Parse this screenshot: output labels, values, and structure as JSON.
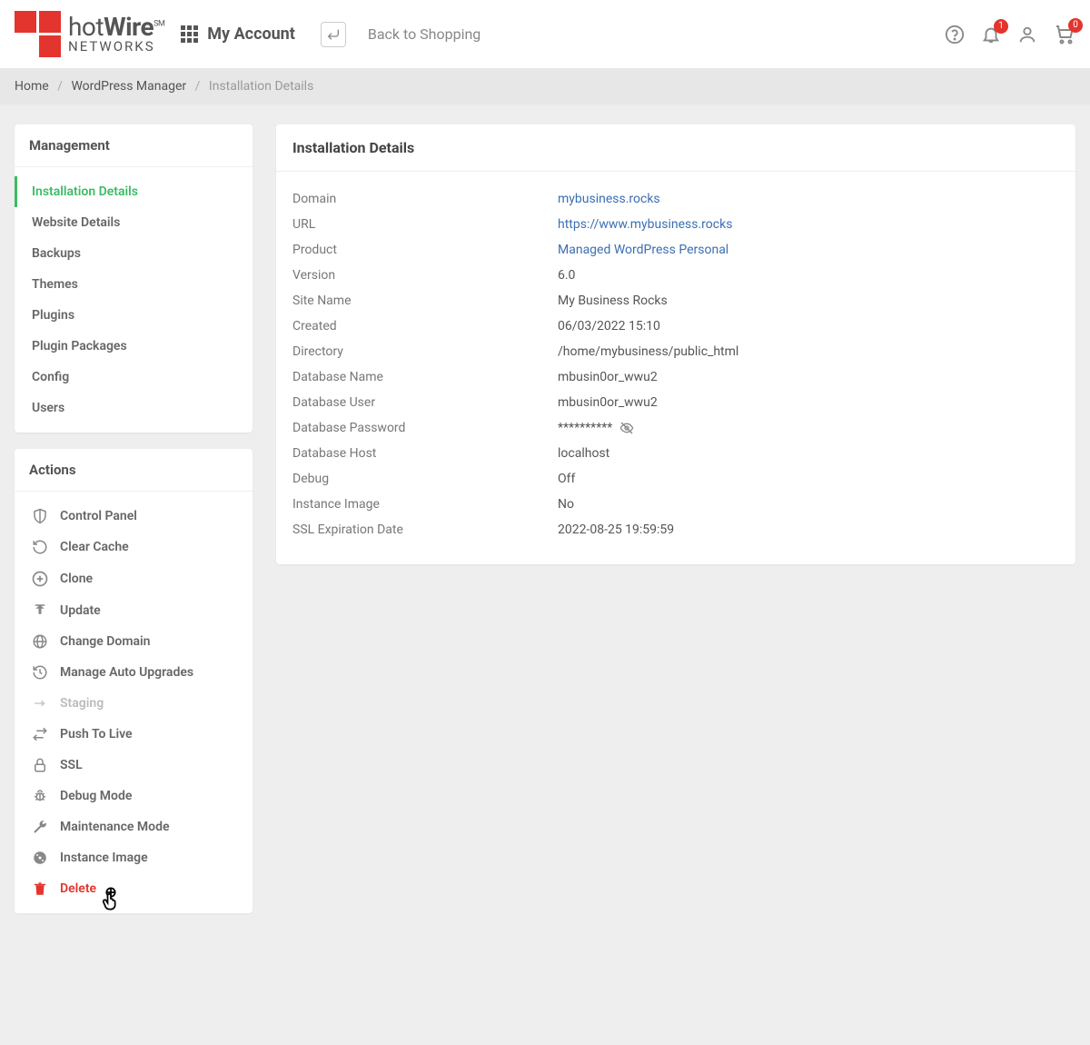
{
  "header": {
    "logo_top1": "hot",
    "logo_top2": "Wire",
    "logo_sm": "SM",
    "logo_bottom": "NETWORKS",
    "my_account": "My Account",
    "back_to_shopping": "Back to Shopping",
    "notifications_count": "1",
    "cart_count": "0"
  },
  "breadcrumb": {
    "home": "Home",
    "wp_manager": "WordPress Manager",
    "current": "Installation Details"
  },
  "management": {
    "title": "Management",
    "items": [
      "Installation Details",
      "Website Details",
      "Backups",
      "Themes",
      "Plugins",
      "Plugin Packages",
      "Config",
      "Users"
    ]
  },
  "actions": {
    "title": "Actions",
    "items": {
      "control_panel": "Control Panel",
      "clear_cache": "Clear Cache",
      "clone": "Clone",
      "update": "Update",
      "change_domain": "Change Domain",
      "auto_upgrades": "Manage Auto Upgrades",
      "staging": "Staging",
      "push_to_live": "Push To Live",
      "ssl": "SSL",
      "debug_mode": "Debug Mode",
      "maintenance_mode": "Maintenance Mode",
      "instance_image": "Instance Image",
      "delete": "Delete"
    }
  },
  "details": {
    "title": "Installation Details",
    "rows": {
      "domain": {
        "label": "Domain",
        "value": "mybusiness.rocks"
      },
      "url": {
        "label": "URL",
        "value": "https://www.mybusiness.rocks"
      },
      "product": {
        "label": "Product",
        "value": "Managed WordPress Personal"
      },
      "version": {
        "label": "Version",
        "value": "6.0"
      },
      "site_name": {
        "label": "Site Name",
        "value": "My Business Rocks"
      },
      "created": {
        "label": "Created",
        "value": "06/03/2022 15:10"
      },
      "directory": {
        "label": "Directory",
        "value": "/home/mybusiness/public_html"
      },
      "db_name": {
        "label": "Database Name",
        "value": "mbusin0or_wwu2"
      },
      "db_user": {
        "label": "Database User",
        "value": "mbusin0or_wwu2"
      },
      "db_pass": {
        "label": "Database Password",
        "value": "**********"
      },
      "db_host": {
        "label": "Database Host",
        "value": "localhost"
      },
      "debug": {
        "label": "Debug",
        "value": "Off"
      },
      "inst_image": {
        "label": "Instance Image",
        "value": "No"
      },
      "ssl_exp": {
        "label": "SSL Expiration Date",
        "value": "2022-08-25 19:59:59"
      }
    }
  }
}
